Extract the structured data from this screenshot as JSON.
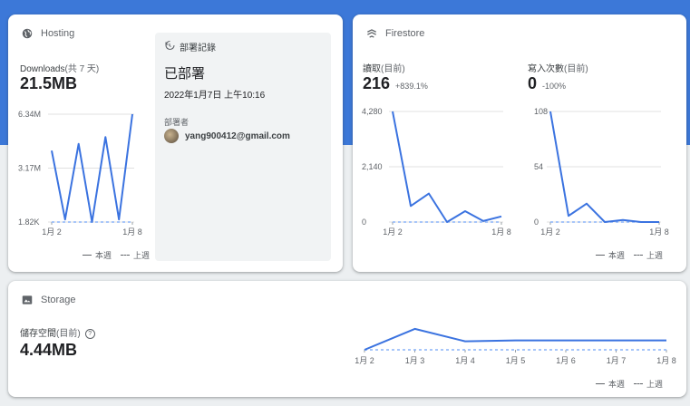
{
  "hosting": {
    "title": "Hosting",
    "icon": "globe-icon",
    "metric_label": "Downloads",
    "metric_suffix": "(共 7 天)",
    "metric_value": "21.5MB",
    "deploy": {
      "title": "部署記錄",
      "icon": "history-icon",
      "status": "已部署",
      "time": "2022年1月7日 上午10:16",
      "by_label": "部署者",
      "user": "yang900412@gmail.com"
    }
  },
  "firestore": {
    "title": "Firestore",
    "icon": "firestore-icon",
    "reads_label": "讀取",
    "reads_suffix": "(目前)",
    "reads_value": "216",
    "reads_delta": "+839.1%",
    "writes_label": "寫入次數",
    "writes_suffix": "(目前)",
    "writes_value": "0",
    "writes_delta": "-100%"
  },
  "storage": {
    "title": "Storage",
    "icon": "storage-icon",
    "metric_label": "儲存空間",
    "metric_suffix": "(目前)",
    "metric_value": "4.44MB"
  },
  "legend": {
    "current": "本週",
    "previous": "上週"
  },
  "colors": {
    "accent": "#3c78d8",
    "line": "#3b73e0",
    "prev": "#8ab4f8",
    "grid": "#e0e0e0"
  },
  "chart_data": [
    {
      "id": "hosting-downloads",
      "type": "line",
      "ytick_labels": [
        "1.82K",
        "3.17M",
        "6.34M"
      ],
      "ylim": [
        0,
        6.34
      ],
      "x_tick_labels": [
        "1月 2",
        "1月 8"
      ],
      "series": [
        {
          "name": "本週",
          "values": [
            4.2,
            0.15,
            4.6,
            0.0,
            5.0,
            0.15,
            6.34
          ]
        },
        {
          "name": "上週",
          "values": [
            0,
            0,
            0,
            0,
            0,
            0,
            0
          ]
        }
      ]
    },
    {
      "id": "firestore-reads",
      "type": "line",
      "ytick_labels": [
        "0",
        "2,140",
        "4,280"
      ],
      "ylim": [
        0,
        4280
      ],
      "x_tick_labels": [
        "1月 2",
        "1月 8"
      ],
      "series": [
        {
          "name": "本週",
          "values": [
            4280,
            620,
            1100,
            0,
            420,
            40,
            216
          ]
        },
        {
          "name": "上週",
          "values": [
            0,
            0,
            0,
            0,
            0,
            0,
            0
          ]
        }
      ]
    },
    {
      "id": "firestore-writes",
      "type": "line",
      "ytick_labels": [
        "0",
        "54",
        "108"
      ],
      "ylim": [
        0,
        108
      ],
      "x_tick_labels": [
        "1月 2",
        "1月 8"
      ],
      "series": [
        {
          "name": "本週",
          "values": [
            108,
            6,
            18,
            0,
            2,
            0,
            0
          ]
        },
        {
          "name": "上週",
          "values": [
            0,
            0,
            0,
            0,
            0,
            0,
            0
          ]
        }
      ]
    },
    {
      "id": "storage-usage",
      "type": "line",
      "ytick_labels": [],
      "ylim": [
        0,
        5
      ],
      "x_tick_labels": [
        "1月 2",
        "1月 3",
        "1月 4",
        "1月 5",
        "1月 6",
        "1月 7",
        "1月 8"
      ],
      "series": [
        {
          "name": "本週",
          "values": [
            0,
            4.44,
            1.8,
            2.0,
            2.0,
            2.0,
            2.0
          ]
        },
        {
          "name": "上週",
          "values": [
            0,
            0,
            0,
            0,
            0,
            0,
            0
          ]
        }
      ]
    }
  ]
}
